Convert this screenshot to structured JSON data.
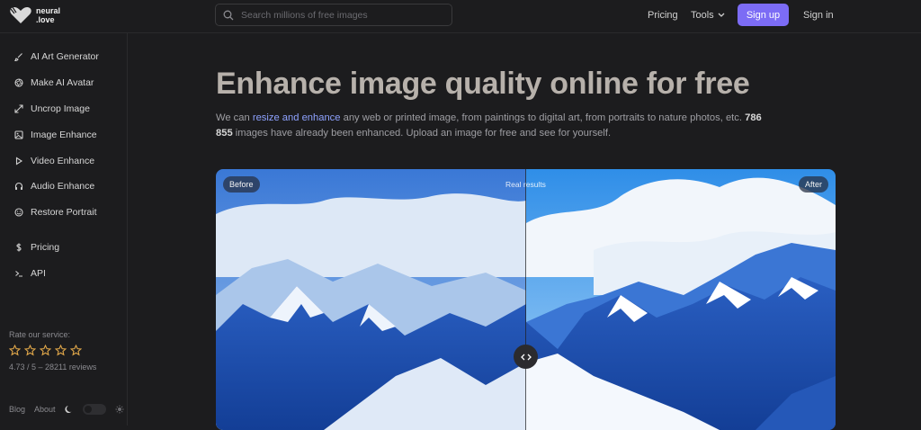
{
  "logo": {
    "line1": "neural",
    "line2": ".love"
  },
  "search": {
    "placeholder": "Search millions of free images"
  },
  "nav": {
    "pricing": "Pricing",
    "tools": "Tools",
    "signup": "Sign up",
    "signin": "Sign in"
  },
  "sidebar": {
    "items": [
      {
        "label": "AI Art Generator",
        "icon": "brush-icon"
      },
      {
        "label": "Make AI Avatar",
        "icon": "aperture-icon"
      },
      {
        "label": "Uncrop Image",
        "icon": "expand-icon"
      },
      {
        "label": "Image Enhance",
        "icon": "image-icon"
      },
      {
        "label": "Video Enhance",
        "icon": "play-icon"
      },
      {
        "label": "Audio Enhance",
        "icon": "headphones-icon"
      },
      {
        "label": "Restore Portrait",
        "icon": "smile-icon"
      },
      {
        "label": "Pricing",
        "icon": "dollar-icon"
      },
      {
        "label": "API",
        "icon": "terminal-icon"
      }
    ],
    "rate_label": "Rate our service:",
    "rating_text": "4.73 / 5 – 28211 reviews",
    "footer": {
      "blog": "Blog",
      "about": "About"
    }
  },
  "main": {
    "headline": "Enhance image quality online for free",
    "desc_pre": "We can ",
    "desc_link": "resize and enhance",
    "desc_mid": " any web or printed image, from paintings to digital art, from portraits to nature photos, etc. ",
    "desc_count": "786 855",
    "desc_post": " images have already been enhanced. Upload an image for free and see for yourself.",
    "compare": {
      "before": "Before",
      "after": "After",
      "caption": "Real results"
    }
  },
  "colors": {
    "accent": "#7c6cf5",
    "link": "#8ea2ff",
    "background": "#1c1c1e"
  }
}
